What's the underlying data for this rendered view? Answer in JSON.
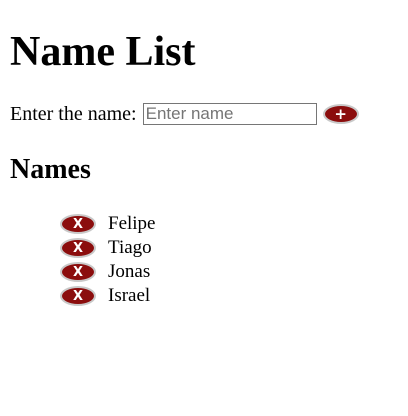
{
  "page": {
    "title": "Name List",
    "section_title": "Names"
  },
  "form": {
    "label": "Enter the name:",
    "input_value": "",
    "input_placeholder": "Enter name",
    "add_icon": "plus-icon",
    "add_glyph": "+"
  },
  "names": {
    "remove_icon": "x-icon",
    "remove_glyph": "X",
    "items": [
      {
        "label": "Felipe"
      },
      {
        "label": "Tiago"
      },
      {
        "label": "Jonas"
      },
      {
        "label": "Israel"
      }
    ]
  },
  "colors": {
    "button_fill": "#8b0d0d",
    "button_border": "#c9c9c9",
    "button_glyph": "#ffffff"
  }
}
